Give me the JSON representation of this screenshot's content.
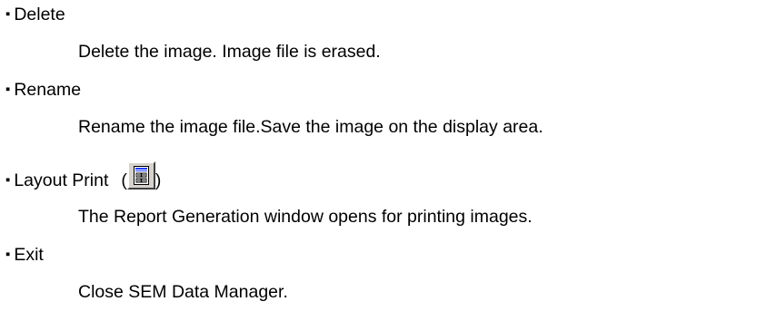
{
  "bullet_glyph": "▪",
  "items": [
    {
      "title": "Delete",
      "description": "Delete the image. Image file is erased."
    },
    {
      "title": "Rename",
      "description": "Rename the image file.Save the image on the display area."
    },
    {
      "title": "Layout Print",
      "paren_open": "(",
      "paren_close": ")",
      "icon": "layout-print-icon",
      "description": "The Report Generation window opens for printing images."
    },
    {
      "title": "Exit",
      "description": "Close SEM Data Manager."
    }
  ],
  "colors": {
    "text": "#000000",
    "button_face": "#d6d3ce",
    "icon_accent": "#1f3cff"
  }
}
